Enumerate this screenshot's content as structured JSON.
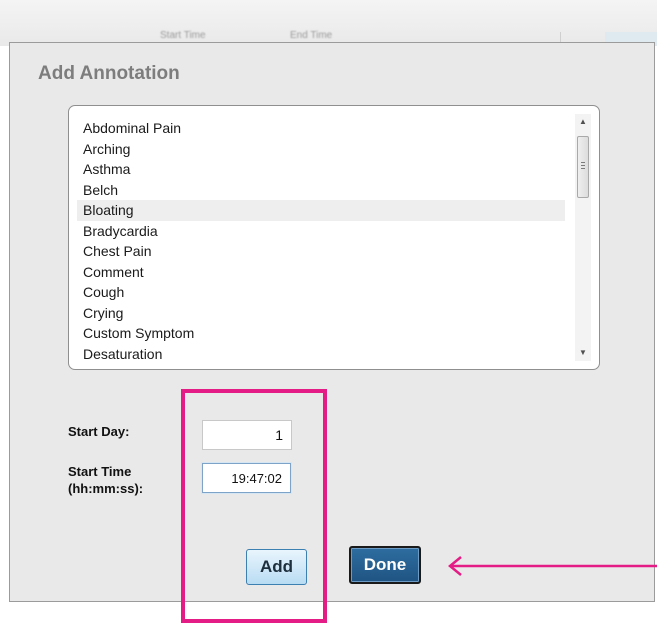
{
  "background": {
    "header_left": "Start Time",
    "header_right": "End Time"
  },
  "dialog": {
    "title": "Add Annotation"
  },
  "annotation_list": {
    "selected_item": "Bloating",
    "items": [
      "Abdominal Pain",
      "Arching",
      "Asthma",
      "Belch",
      "Bloating",
      "Bradycardia",
      "Chest Pain",
      "Comment",
      "Cough",
      "Crying",
      "Custom Symptom",
      "Desaturation"
    ],
    "scroll_position": 0.05
  },
  "form": {
    "start_day_label": "Start Day:",
    "start_day_value": "1",
    "start_time_label_line1": "Start Time",
    "start_time_label_line2": "(hh:mm:ss):",
    "start_time_value": "19:47:02"
  },
  "buttons": {
    "add_label": "Add",
    "done_label": "Done"
  },
  "icons": {
    "scroll_up": "scroll-up-arrow-icon",
    "scroll_down": "scroll-down-arrow-icon",
    "annotation_arrow": "left-arrow-icon"
  },
  "colors": {
    "highlight": "#e41c85",
    "done_button": "#1f5483",
    "add_button": "#b9dcf3",
    "dialog_background": "#e9e9e9"
  }
}
